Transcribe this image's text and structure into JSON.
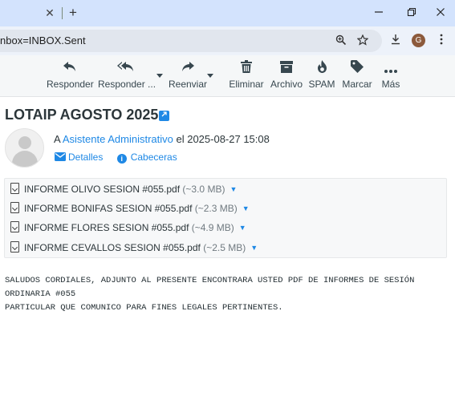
{
  "browser": {
    "tab_close": "✕",
    "new_tab": "+",
    "url": "nbox=INBOX.Sent",
    "profile_initial": "G"
  },
  "toolbar": {
    "reply": "Responder",
    "reply_all": "Responder ...",
    "forward": "Reenviar",
    "delete": "Eliminar",
    "archive": "Archivo",
    "spam": "SPAM",
    "mark": "Marcar",
    "more": "Más"
  },
  "message": {
    "subject": "LOTAIP AGOSTO 2025",
    "to_prefix": "A ",
    "recipient": "Asistente Administrativo",
    "date_text": " el 2025-08-27 15:08",
    "details_link": "Detalles",
    "headers_link": "Cabeceras"
  },
  "attachments": [
    {
      "name": "INFORME OLIVO SESION #055.pdf",
      "size": "(~3.0 MB)"
    },
    {
      "name": "INFORME BONIFAS SESION #055.pdf",
      "size": "(~2.3 MB)"
    },
    {
      "name": "INFORME FLORES SESION #055.pdf",
      "size": "(~4.9 MB)"
    },
    {
      "name": "INFORME CEVALLOS SESION #055.pdf",
      "size": "(~2.5 MB)"
    }
  ],
  "body_text": "SALUDOS CORDIALES, ADJUNTO AL PRESENTE ENCONTRARA USTED PDF DE INFORMES DE SESIÓN\nORDINARIA #055\nPARTICULAR QUE COMUNICO PARA FINES LEGALES PERTINENTES.",
  "colors": {
    "accent": "#1e88e5",
    "tabbar": "#d3e3fd",
    "toolbar_bg": "#f5f7f8"
  }
}
